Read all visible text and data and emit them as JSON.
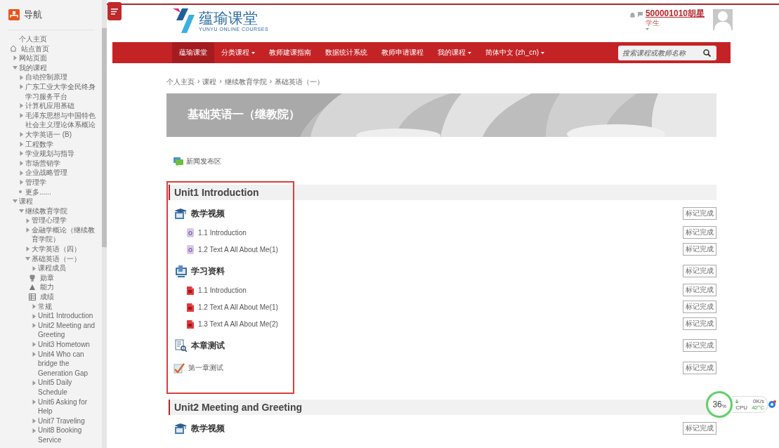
{
  "sidebar": {
    "title": "导航",
    "tree": [
      {
        "label": "个人主页",
        "kind": "text"
      },
      {
        "label": "站点首页",
        "kind": "site"
      },
      {
        "label": "网站页面",
        "kind": "branch",
        "expanded": false
      },
      {
        "label": "我的课程",
        "kind": "branch",
        "expanded": true,
        "children": [
          {
            "label": "自动控制原理",
            "kind": "branch",
            "expanded": false
          },
          {
            "label": "广东工业大学全民终身学习服务平台",
            "kind": "branch",
            "expanded": false
          },
          {
            "label": "计算机应用基础",
            "kind": "branch",
            "expanded": false
          },
          {
            "label": "毛泽东思想与中国特色社会主义理论体系概论",
            "kind": "branch",
            "expanded": false
          },
          {
            "label": "大学英语一 (B)",
            "kind": "branch",
            "expanded": false
          },
          {
            "label": "工程数学",
            "kind": "branch",
            "expanded": false
          },
          {
            "label": "学业规划与指导",
            "kind": "branch",
            "expanded": false
          },
          {
            "label": "市场营销学",
            "kind": "branch",
            "expanded": false
          },
          {
            "label": "企业战略管理",
            "kind": "branch",
            "expanded": false
          },
          {
            "label": "管理学",
            "kind": "branch",
            "expanded": false
          },
          {
            "label": "更多......",
            "kind": "more"
          }
        ]
      },
      {
        "label": "课程",
        "kind": "branch",
        "expanded": true,
        "children": [
          {
            "label": "继续教育学院",
            "kind": "branch",
            "expanded": true,
            "children": [
              {
                "label": "管理心理学",
                "kind": "branch",
                "expanded": false
              },
              {
                "label": "金融学概论（继续教育学院）",
                "kind": "branch",
                "expanded": false
              },
              {
                "label": "大学英语（四）",
                "kind": "branch",
                "expanded": false
              },
              {
                "label": "基础英语（一）",
                "kind": "branch",
                "expanded": true,
                "children": [
                  {
                    "label": "课程成员",
                    "kind": "branch",
                    "expanded": false
                  },
                  {
                    "label": "勋章",
                    "kind": "badges"
                  },
                  {
                    "label": "能力",
                    "kind": "competencies"
                  },
                  {
                    "label": "成绩",
                    "kind": "grades"
                  },
                  {
                    "label": "常规",
                    "kind": "branch",
                    "expanded": false
                  },
                  {
                    "label": "Unit1 Introduction",
                    "kind": "branch",
                    "expanded": false
                  },
                  {
                    "label": "Unit2 Meeting and Greeting",
                    "kind": "branch",
                    "expanded": false
                  },
                  {
                    "label": "Unit3 Hometown",
                    "kind": "branch",
                    "expanded": false
                  },
                  {
                    "label": "Unit4 Who can bridge the Generation Gap",
                    "kind": "branch",
                    "expanded": false
                  },
                  {
                    "label": "Unit5 Daily Schedule",
                    "kind": "branch",
                    "expanded": false
                  },
                  {
                    "label": "Unit6 Asking for Help",
                    "kind": "branch",
                    "expanded": false
                  },
                  {
                    "label": "Unit7 Traveling",
                    "kind": "branch",
                    "expanded": false
                  },
                  {
                    "label": "Unit8 Booking Service",
                    "kind": "branch",
                    "expanded": false
                  }
                ]
              }
            ]
          }
        ]
      }
    ]
  },
  "header": {
    "logo_name": "蕴瑜课堂",
    "logo_tagline": "YUNYU ONLINE COURSES",
    "user": {
      "name": "500001010胡星",
      "role": "学生"
    }
  },
  "nav": {
    "items": [
      {
        "label": "蕴瑜课堂",
        "dropdown": false,
        "selected": true
      },
      {
        "label": "分类课程",
        "dropdown": true,
        "selected": false
      },
      {
        "label": "教师建课指南",
        "dropdown": false,
        "selected": false
      },
      {
        "label": "数据统计系统",
        "dropdown": false,
        "selected": false
      },
      {
        "label": "教师申请课程",
        "dropdown": false,
        "selected": false
      },
      {
        "label": "我的课程",
        "dropdown": true,
        "selected": false
      },
      {
        "label": "简体中文 (zh_cn)",
        "dropdown": true,
        "selected": false
      }
    ],
    "search": {
      "placeholder": "搜索课程或教师名称"
    }
  },
  "breadcrumb": {
    "separator": "›",
    "items": [
      "个人主页",
      "课程",
      "继续教育学院",
      "基础英语（一）"
    ]
  },
  "course_title": "基础英语一（继教院）",
  "news_forum": "新闻发布区",
  "sections": [
    {
      "title": "Unit1 Introduction",
      "highlighted": true,
      "items": [
        {
          "kind": "lectures",
          "text": "教学视频",
          "button": "标记完成"
        },
        {
          "kind": "media",
          "text": "1.1 Introduction",
          "button": "标记完成"
        },
        {
          "kind": "media",
          "text": "1.2 Text A All About Me(1)",
          "button": "标记完成"
        },
        {
          "kind": "materials",
          "text": "学习资料",
          "button": "标记完成"
        },
        {
          "kind": "document",
          "text": "1.1 Introduction",
          "button": "标记完成"
        },
        {
          "kind": "document",
          "text": "1.2 Text A All About Me(1)",
          "button": "标记完成"
        },
        {
          "kind": "document",
          "text": "1.3 Text A All About Me(2)",
          "button": "标记完成"
        },
        {
          "kind": "tests",
          "text": "本章测试",
          "button": "标记完成"
        },
        {
          "kind": "quiz",
          "text": "第一章测试",
          "button": "标记完成"
        }
      ]
    },
    {
      "title": "Unit2 Meeting and Greeting",
      "highlighted": false,
      "items": [
        {
          "kind": "lectures",
          "text": "教学视频",
          "button": "标记完成"
        }
      ]
    }
  ],
  "system_monitor": {
    "percent": "36",
    "percent_sign": "%",
    "speed": "0K/s",
    "cpu_label": "CPU",
    "temperature": "42°C"
  }
}
